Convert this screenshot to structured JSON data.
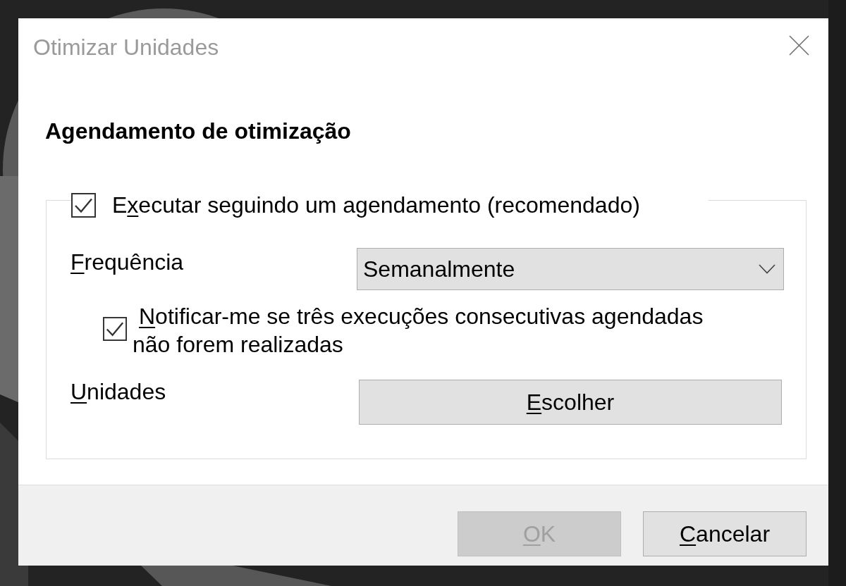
{
  "window": {
    "title": "Otimizar Unidades"
  },
  "heading": "Agendamento de otimização",
  "schedule": {
    "checked": true,
    "label": {
      "before": "E",
      "access_key": "x",
      "after": "ecutar seguindo um agendamento (recomendado)"
    },
    "frequency": {
      "label": {
        "access_key": "F",
        "after": "requência"
      },
      "value": "Semanalmente"
    },
    "notify": {
      "checked": true,
      "label": {
        "access_key": "N",
        "after": "otificar-me se três execuções consecutivas agendadas\nnão forem realizadas"
      }
    },
    "drives": {
      "label": {
        "access_key": "U",
        "after": "nidades"
      },
      "button": {
        "access_key": "E",
        "after": "scolher"
      }
    }
  },
  "buttons": [
    {
      "label": {
        "access_key": "O",
        "after": "K"
      },
      "disabled": true
    },
    {
      "label": {
        "access_key": "C",
        "after": "ancelar"
      },
      "disabled": false
    }
  ]
}
